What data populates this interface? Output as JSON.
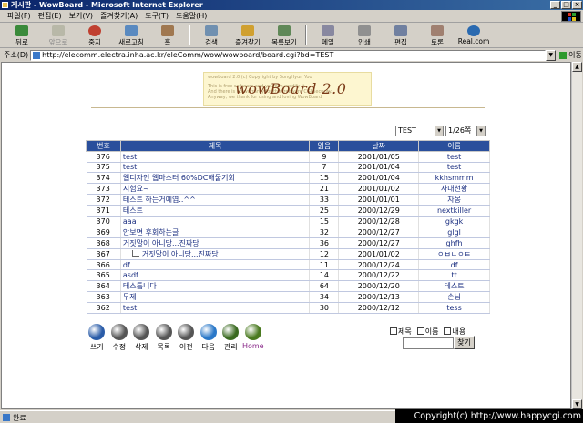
{
  "window": {
    "title": "게시판 - WowBoard - Microsoft Internet Explorer"
  },
  "menu": [
    "파일(F)",
    "편집(E)",
    "보기(V)",
    "즐겨찾기(A)",
    "도구(T)",
    "도움말(H)"
  ],
  "toolbar": {
    "back": "뒤로",
    "forward": "앞으로",
    "stop": "중지",
    "refresh": "새로고침",
    "home": "홈",
    "search": "검색",
    "favorites": "즐겨찾기",
    "history": "목록보기",
    "mail": "메일",
    "print": "인쇄",
    "edit": "편집",
    "discuss": "토론",
    "realcom": "Real.com"
  },
  "address": {
    "label": "주소(D)",
    "url": "http://elecomm.electra.inha.ac.kr/eleComm/wow/wowboard/board.cgi?bd=TEST",
    "go": "이동"
  },
  "banner": {
    "logo": "wowBoard 2.0",
    "fine1": "wowboard 2.0 (c) Copyright by SongHyun Yoo",
    "fine2": "This is free software and you can modify it",
    "fine3": "And there is no warranty for the freeware CGI security.",
    "fine4": "Anyway, we thank for using and loving WowBoard"
  },
  "controls": {
    "board_select": "TEST",
    "page_select": "1/26쪽"
  },
  "board": {
    "headers": {
      "num": "번호",
      "title": "제목",
      "views": "읽음",
      "date": "날짜",
      "name": "이름"
    },
    "rows": [
      {
        "num": "376",
        "title": "test",
        "views": "9",
        "date": "2001/01/05",
        "name": "test",
        "reply": false
      },
      {
        "num": "375",
        "title": "test",
        "views": "7",
        "date": "2001/01/04",
        "name": "test",
        "reply": false
      },
      {
        "num": "374",
        "title": "웹디자인 웹마스터 60%DC해물기회",
        "views": "15",
        "date": "2001/01/04",
        "name": "kkhsmmm",
        "reply": false
      },
      {
        "num": "373",
        "title": "시험요~",
        "views": "21",
        "date": "2001/01/02",
        "name": "사대천황",
        "reply": false
      },
      {
        "num": "372",
        "title": "테스트 하는거예염..^^",
        "views": "33",
        "date": "2001/01/01",
        "name": "자몽",
        "reply": false
      },
      {
        "num": "371",
        "title": "테스트",
        "views": "25",
        "date": "2000/12/29",
        "name": "nextkiller",
        "reply": false
      },
      {
        "num": "370",
        "title": "aaa",
        "views": "15",
        "date": "2000/12/28",
        "name": "gkgk",
        "reply": false
      },
      {
        "num": "369",
        "title": "안보면 후회하는글",
        "views": "32",
        "date": "2000/12/27",
        "name": "glgl",
        "reply": false
      },
      {
        "num": "368",
        "title": "거짓말이 아니당...진짜당",
        "views": "36",
        "date": "2000/12/27",
        "name": "ghfh",
        "reply": false
      },
      {
        "num": "367",
        "title": "거짓말이 아니당...진짜당",
        "views": "12",
        "date": "2001/01/02",
        "name": "ㅇㅂㄴㅇㅌ",
        "reply": true
      },
      {
        "num": "366",
        "title": "df",
        "views": "11",
        "date": "2000/12/24",
        "name": "df",
        "reply": false
      },
      {
        "num": "365",
        "title": "asdf",
        "views": "14",
        "date": "2000/12/22",
        "name": "tt",
        "reply": false
      },
      {
        "num": "364",
        "title": "테스틉니다",
        "views": "64",
        "date": "2000/12/20",
        "name": "테스트",
        "reply": false
      },
      {
        "num": "363",
        "title": "무제",
        "views": "34",
        "date": "2000/12/13",
        "name": "손님",
        "reply": false
      },
      {
        "num": "362",
        "title": "test",
        "views": "30",
        "date": "2000/12/12",
        "name": "tess",
        "reply": false
      }
    ]
  },
  "nav": [
    {
      "label": "쓰기",
      "color": "#2a5ca8",
      "icon": "write-icon"
    },
    {
      "label": "수정",
      "color": "#555555",
      "icon": "edit-icon"
    },
    {
      "label": "삭제",
      "color": "#555555",
      "icon": "delete-icon"
    },
    {
      "label": "목록",
      "color": "#555555",
      "icon": "list-icon"
    },
    {
      "label": "이전",
      "color": "#555555",
      "icon": "previous-icon"
    },
    {
      "label": "다음",
      "color": "#2a78c8",
      "icon": "next-icon"
    },
    {
      "label": "관리",
      "color": "#3a6a20",
      "icon": "admin-icon"
    },
    {
      "label": "Home",
      "color": "#4a7a20",
      "icon": "home-icon"
    }
  ],
  "search": {
    "opt_title": "제목",
    "opt_name": "이름",
    "opt_content": "내용",
    "button": "찾기",
    "value": ""
  },
  "status": {
    "text": "완료",
    "copyright": "Copyright(c) http://www.happycgi.com"
  }
}
